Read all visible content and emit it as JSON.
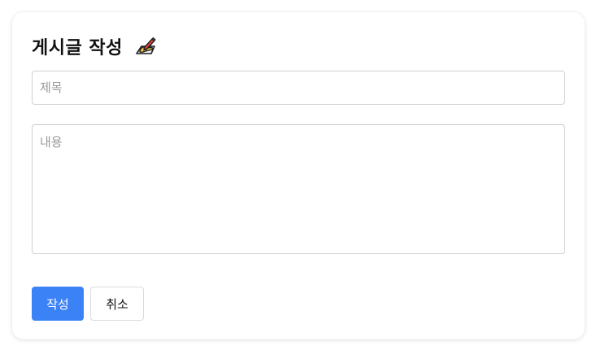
{
  "form": {
    "title": "게시글 작성",
    "title_icon": "writing-hand-icon",
    "title_placeholder": "제목",
    "content_placeholder": "내용",
    "title_value": "",
    "content_value": ""
  },
  "buttons": {
    "submit_label": "작성",
    "cancel_label": "취소"
  },
  "colors": {
    "primary": "#3b82f6",
    "border": "#cfcfcf",
    "placeholder": "#9a9a9a"
  }
}
